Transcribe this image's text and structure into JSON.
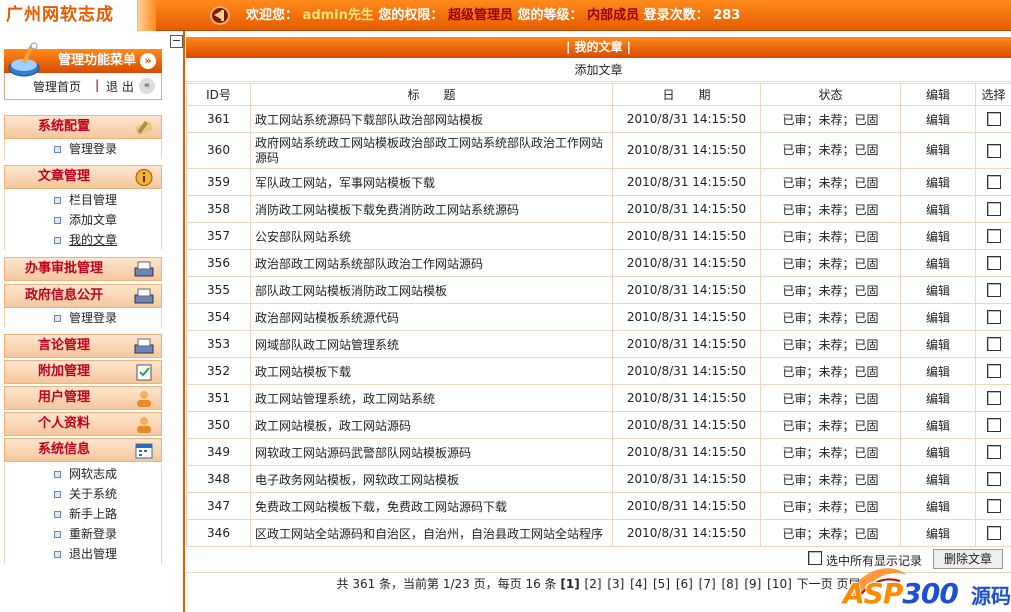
{
  "header": {
    "logo_text": "广州网软志成",
    "welcome_label": "欢迎您：",
    "user_name": "admin先生",
    "permission_label": "您的权限：",
    "permission_value": "超级管理员",
    "level_label": "您的等级：",
    "level_value": "内部成员",
    "login_count_label": "登录次数：",
    "login_count": "283"
  },
  "sidebar": {
    "menu_title": "管理功能菜单",
    "home_label": "管理首页",
    "separator": "|",
    "logout_label": "退 出",
    "sections": [
      {
        "title": "系统配置",
        "items": [
          "管理登录"
        ]
      },
      {
        "title": "文章管理",
        "items": [
          "栏目管理",
          "添加文章",
          "我的文章"
        ]
      },
      {
        "title": "办事审批管理",
        "items": []
      },
      {
        "title": "政府信息公开",
        "items": [
          "管理登录"
        ]
      },
      {
        "title": "言论管理",
        "items": []
      },
      {
        "title": "附加管理",
        "items": []
      },
      {
        "title": "用户管理",
        "items": []
      },
      {
        "title": "个人资料",
        "items": []
      },
      {
        "title": "系统信息",
        "items": [
          "网软志成",
          "关于系统",
          "新手上路",
          "重新登录",
          "退出管理"
        ]
      }
    ]
  },
  "main": {
    "title": "| 我的文章 |",
    "add_link": "添加文章",
    "columns": [
      "ID号",
      "标　　题",
      "日　　期",
      "状态",
      "编辑",
      "选择"
    ],
    "rows": [
      {
        "id": "361",
        "title": "政工网站系统源码下载部队政治部网站模板",
        "date": "2010/8/31 14:15:50",
        "status": "已审；未荐；已固",
        "edit": "编辑"
      },
      {
        "id": "360",
        "title": "政府网站系统政工网站模板政治部政工网站系统部队政治工作网站源码",
        "date": "2010/8/31 14:15:50",
        "status": "已审；未荐；已固",
        "edit": "编辑"
      },
      {
        "id": "359",
        "title": "军队政工网站，军事网站模板下载",
        "date": "2010/8/31 14:15:50",
        "status": "已审；未荐；已固",
        "edit": "编辑"
      },
      {
        "id": "358",
        "title": "消防政工网站模板下载免费消防政工网站系统源码",
        "date": "2010/8/31 14:15:50",
        "status": "已审；未荐；已固",
        "edit": "编辑"
      },
      {
        "id": "357",
        "title": "公安部队网站系统",
        "date": "2010/8/31 14:15:50",
        "status": "已审；未荐；已固",
        "edit": "编辑"
      },
      {
        "id": "356",
        "title": "政治部政工网站系统部队政治工作网站源码",
        "date": "2010/8/31 14:15:50",
        "status": "已审；未荐；已固",
        "edit": "编辑"
      },
      {
        "id": "355",
        "title": "部队政工网站模板消防政工网站模板",
        "date": "2010/8/31 14:15:50",
        "status": "已审；未荐；已固",
        "edit": "编辑"
      },
      {
        "id": "354",
        "title": "政治部网站模板系统源代码",
        "date": "2010/8/31 14:15:50",
        "status": "已审；未荐；已固",
        "edit": "编辑"
      },
      {
        "id": "353",
        "title": "网域部队政工网站管理系统",
        "date": "2010/8/31 14:15:50",
        "status": "已审；未荐；已固",
        "edit": "编辑"
      },
      {
        "id": "352",
        "title": "政工网站模板下载",
        "date": "2010/8/31 14:15:50",
        "status": "已审；未荐；已固",
        "edit": "编辑"
      },
      {
        "id": "351",
        "title": "政工网站管理系统，政工网站系统",
        "date": "2010/8/31 14:15:50",
        "status": "已审；未荐；已固",
        "edit": "编辑"
      },
      {
        "id": "350",
        "title": "政工网站模板，政工网站源码",
        "date": "2010/8/31 14:15:50",
        "status": "已审；未荐；已固",
        "edit": "编辑"
      },
      {
        "id": "349",
        "title": "网软政工网站源码武警部队网站模板源码",
        "date": "2010/8/31 14:15:50",
        "status": "已审；未荐；已固",
        "edit": "编辑"
      },
      {
        "id": "348",
        "title": "电子政务网站模板，网软政工网站模板",
        "date": "2010/8/31 14:15:50",
        "status": "已审；未荐；已固",
        "edit": "编辑"
      },
      {
        "id": "347",
        "title": "免费政工网站模板下载，免费政工网站源码下载",
        "date": "2010/8/31 14:15:50",
        "status": "已审；未荐；已固",
        "edit": "编辑"
      },
      {
        "id": "346",
        "title": "区政工网站全站源码和自治区，自治州，自治县政工网站全站程序",
        "date": "2010/8/31 14:15:50",
        "status": "已审；未荐；已固",
        "edit": "编辑"
      }
    ],
    "select_all_label": "选中所有显示记录",
    "delete_button": "删除文章",
    "pager": {
      "prefix": "共 361 条，当前第 1/23 页，每页 16 条",
      "current": "[1]",
      "pages": [
        "[2]",
        "[3]",
        "[4]",
        "[5]",
        "[6]",
        "[7]",
        "[8]",
        "[9]",
        "[10]"
      ],
      "next": "下一页",
      "last": "页尾"
    }
  },
  "watermark": {
    "asp": "ASP",
    "num": "300",
    "cn": "源码"
  },
  "colors": {
    "accent": "#ff8a1c",
    "accent_dark": "#d94a00",
    "section_text": "#c1001f",
    "highlight": "#ffe27a",
    "border": "#f3d4be"
  }
}
